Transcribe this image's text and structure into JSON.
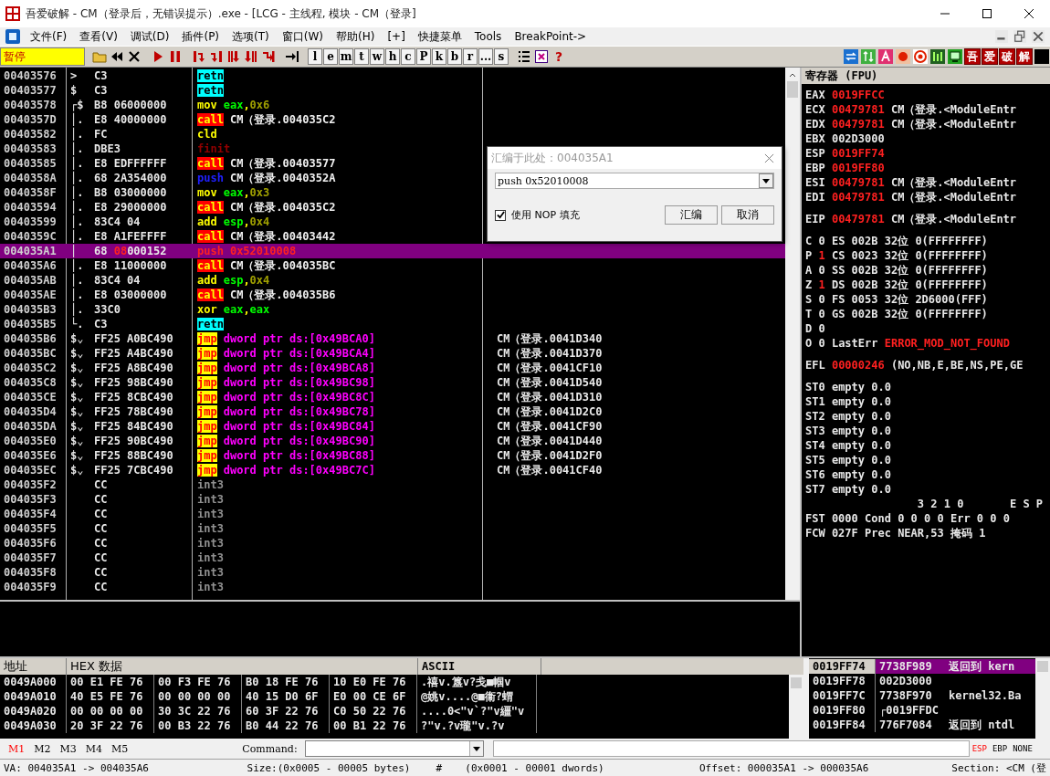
{
  "window": {
    "title": "吾爱破解 - CM（登录后，无错误提示）.exe - [LCG -  主线程, 模块 - CM（登录]"
  },
  "menu": [
    "文件(F)",
    "查看(V)",
    "调试(D)",
    "插件(P)",
    "选项(T)",
    "窗口(W)",
    "帮助(H)",
    "[+]",
    "快捷菜单",
    "Tools",
    "BreakPoint->"
  ],
  "toolbar": {
    "status": "暂停",
    "letter_buttons": [
      "l",
      "e",
      "m",
      "t",
      "w",
      "h",
      "c",
      "P",
      "k",
      "b",
      "r",
      "...",
      "s"
    ],
    "help": "?",
    "brand_buttons": [
      "吾",
      "爱",
      "破",
      "解"
    ]
  },
  "disassembly": {
    "rows": [
      {
        "address": "00403576",
        "mark": ">",
        "bytes": "C3",
        "mnemonic": "retn",
        "kind": "return",
        "operands": [],
        "selected": false
      },
      {
        "address": "00403577",
        "mark": "$",
        "bytes": "C3",
        "mnemonic": "retn",
        "kind": "return",
        "operands": [],
        "selected": false
      },
      {
        "address": "00403578",
        "mark": "┌$",
        "bytes": "B8 06000000",
        "mnemonic": "mov",
        "kind": "plain",
        "operands": [
          {
            "text": "eax",
            "kind": "reg"
          },
          {
            "text": ",",
            "kind": "punct"
          },
          {
            "text": "0x6",
            "kind": "imm"
          }
        ],
        "selected": false
      },
      {
        "address": "0040357D",
        "mark": "│.",
        "bytes": "E8 40000000",
        "mnemonic": "call",
        "kind": "call",
        "operands": [
          {
            "text": "CM（登录.004035C2",
            "kind": "symbol"
          }
        ],
        "selected": false
      },
      {
        "address": "00403582",
        "mark": "│.",
        "bytes": "FC",
        "mnemonic": "cld",
        "kind": "plain",
        "operands": [],
        "selected": false
      },
      {
        "address": "00403583",
        "mark": "│.",
        "bytes": "DBE3",
        "mnemonic": "finit",
        "kind": "fpu",
        "operands": [],
        "selected": false
      },
      {
        "address": "00403585",
        "mark": "│.",
        "bytes": "E8 EDFFFFFF",
        "mnemonic": "call",
        "kind": "call",
        "operands": [
          {
            "text": "CM（登录.00403577",
            "kind": "symbol"
          }
        ],
        "selected": false
      },
      {
        "address": "0040358A",
        "mark": "│.",
        "bytes": "68 2A354000",
        "mnemonic": "push",
        "kind": "push",
        "operands": [
          {
            "text": "CM（登录.0040352A",
            "kind": "symbol"
          }
        ],
        "selected": false
      },
      {
        "address": "0040358F",
        "mark": "│.",
        "bytes": "B8 03000000",
        "mnemonic": "mov",
        "kind": "plain",
        "operands": [
          {
            "text": "eax",
            "kind": "reg"
          },
          {
            "text": ",",
            "kind": "punct"
          },
          {
            "text": "0x3",
            "kind": "imm"
          }
        ],
        "selected": false
      },
      {
        "address": "00403594",
        "mark": "│.",
        "bytes": "E8 29000000",
        "mnemonic": "call",
        "kind": "call",
        "operands": [
          {
            "text": "CM（登录.004035C2",
            "kind": "symbol"
          }
        ],
        "selected": false
      },
      {
        "address": "00403599",
        "mark": "│.",
        "bytes": "83C4 04",
        "mnemonic": "add",
        "kind": "plain",
        "operands": [
          {
            "text": "esp",
            "kind": "reg"
          },
          {
            "text": ",",
            "kind": "punct"
          },
          {
            "text": "0x4",
            "kind": "imm"
          }
        ],
        "selected": false
      },
      {
        "address": "0040359C",
        "mark": "│.",
        "bytes": "E8 A1FEFFFF",
        "mnemonic": "call",
        "kind": "call",
        "operands": [
          {
            "text": "CM（登录.00403442",
            "kind": "symbol"
          }
        ],
        "selected": false
      },
      {
        "address": "004035A1",
        "mark": "│",
        "bytes": [
          {
            "text": "68 ",
            "changed": false
          },
          {
            "text": "08",
            "changed": true
          },
          {
            "text": "000152",
            "changed": false
          }
        ],
        "mnemonic": "push",
        "kind": "push",
        "operands": [
          {
            "text": "0x52010008",
            "kind": "imm"
          }
        ],
        "selected": true
      },
      {
        "address": "004035A6",
        "mark": "│.",
        "bytes": "E8 11000000",
        "mnemonic": "call",
        "kind": "call",
        "operands": [
          {
            "text": "CM（登录.004035BC",
            "kind": "symbol"
          }
        ],
        "selected": false
      },
      {
        "address": "004035AB",
        "mark": "│.",
        "bytes": "83C4 04",
        "mnemonic": "add",
        "kind": "plain",
        "operands": [
          {
            "text": "esp",
            "kind": "reg"
          },
          {
            "text": ",",
            "kind": "punct"
          },
          {
            "text": "0x4",
            "kind": "imm"
          }
        ],
        "selected": false
      },
      {
        "address": "004035AE",
        "mark": "│.",
        "bytes": "E8 03000000",
        "mnemonic": "call",
        "kind": "call",
        "operands": [
          {
            "text": "CM（登录.004035B6",
            "kind": "symbol"
          }
        ],
        "selected": false
      },
      {
        "address": "004035B3",
        "mark": "│.",
        "bytes": "33C0",
        "mnemonic": "xor",
        "kind": "plain",
        "operands": [
          {
            "text": "eax",
            "kind": "reg"
          },
          {
            "text": ",",
            "kind": "punct"
          },
          {
            "text": "eax",
            "kind": "reg"
          }
        ],
        "selected": false
      },
      {
        "address": "004035B5",
        "mark": "└.",
        "bytes": "C3",
        "mnemonic": "retn",
        "kind": "return",
        "operands": [],
        "selected": false
      },
      {
        "address": "004035B6",
        "mark": "$⌄",
        "bytes": "FF25 A0BC490",
        "mnemonic": "jmp",
        "kind": "jump",
        "operands": [
          {
            "text": "dword ptr ds:[0x49BCA0]",
            "kind": "mem"
          }
        ],
        "comment": "CM（登录.0041D340",
        "selected": false
      },
      {
        "address": "004035BC",
        "mark": "$⌄",
        "bytes": "FF25 A4BC490",
        "mnemonic": "jmp",
        "kind": "jump",
        "operands": [
          {
            "text": "dword ptr ds:[0x49BCA4]",
            "kind": "mem"
          }
        ],
        "comment": "CM（登录.0041D370",
        "selected": false
      },
      {
        "address": "004035C2",
        "mark": "$⌄",
        "bytes": "FF25 A8BC490",
        "mnemonic": "jmp",
        "kind": "jump",
        "operands": [
          {
            "text": "dword ptr ds:[0x49BCA8]",
            "kind": "mem"
          }
        ],
        "comment": "CM（登录.0041CF10",
        "selected": false
      },
      {
        "address": "004035C8",
        "mark": "$⌄",
        "bytes": "FF25 98BC490",
        "mnemonic": "jmp",
        "kind": "jump",
        "operands": [
          {
            "text": "dword ptr ds:[0x49BC98]",
            "kind": "mem"
          }
        ],
        "comment": "CM（登录.0041D540",
        "selected": false
      },
      {
        "address": "004035CE",
        "mark": "$⌄",
        "bytes": "FF25 8CBC490",
        "mnemonic": "jmp",
        "kind": "jump",
        "operands": [
          {
            "text": "dword ptr ds:[0x49BC8C]",
            "kind": "mem"
          }
        ],
        "comment": "CM（登录.0041D310",
        "selected": false
      },
      {
        "address": "004035D4",
        "mark": "$⌄",
        "bytes": "FF25 78BC490",
        "mnemonic": "jmp",
        "kind": "jump",
        "operands": [
          {
            "text": "dword ptr ds:[0x49BC78]",
            "kind": "mem"
          }
        ],
        "comment": "CM（登录.0041D2C0",
        "selected": false
      },
      {
        "address": "004035DA",
        "mark": "$⌄",
        "bytes": "FF25 84BC490",
        "mnemonic": "jmp",
        "kind": "jump",
        "operands": [
          {
            "text": "dword ptr ds:[0x49BC84]",
            "kind": "mem"
          }
        ],
        "comment": "CM（登录.0041CF90",
        "selected": false
      },
      {
        "address": "004035E0",
        "mark": "$⌄",
        "bytes": "FF25 90BC490",
        "mnemonic": "jmp",
        "kind": "jump",
        "operands": [
          {
            "text": "dword ptr ds:[0x49BC90]",
            "kind": "mem"
          }
        ],
        "comment": "CM（登录.0041D440",
        "selected": false
      },
      {
        "address": "004035E6",
        "mark": "$⌄",
        "bytes": "FF25 88BC490",
        "mnemonic": "jmp",
        "kind": "jump",
        "operands": [
          {
            "text": "dword ptr ds:[0x49BC88]",
            "kind": "mem"
          }
        ],
        "comment": "CM（登录.0041D2F0",
        "selected": false
      },
      {
        "address": "004035EC",
        "mark": "$⌄",
        "bytes": "FF25 7CBC490",
        "mnemonic": "jmp",
        "kind": "jump",
        "operands": [
          {
            "text": "dword ptr ds:[0x49BC7C]",
            "kind": "mem"
          }
        ],
        "comment": "CM（登录.0041CF40",
        "selected": false
      },
      {
        "address": "004035F2",
        "bytes": "CC",
        "mnemonic": "int3",
        "kind": "pad",
        "operands": [],
        "selected": false
      },
      {
        "address": "004035F3",
        "bytes": "CC",
        "mnemonic": "int3",
        "kind": "pad",
        "operands": [],
        "selected": false
      },
      {
        "address": "004035F4",
        "bytes": "CC",
        "mnemonic": "int3",
        "kind": "pad",
        "operands": [],
        "selected": false
      },
      {
        "address": "004035F5",
        "bytes": "CC",
        "mnemonic": "int3",
        "kind": "pad",
        "operands": [],
        "selected": false
      },
      {
        "address": "004035F6",
        "bytes": "CC",
        "mnemonic": "int3",
        "kind": "pad",
        "operands": [],
        "selected": false
      },
      {
        "address": "004035F7",
        "bytes": "CC",
        "mnemonic": "int3",
        "kind": "pad",
        "operands": [],
        "selected": false
      },
      {
        "address": "004035F8",
        "bytes": "CC",
        "mnemonic": "int3",
        "kind": "pad",
        "operands": [],
        "selected": false
      },
      {
        "address": "004035F9",
        "bytes": "CC",
        "mnemonic": "int3",
        "kind": "pad",
        "operands": [],
        "selected": false
      }
    ]
  },
  "assemble_dialog": {
    "title": "汇编于此处：004035A1",
    "value": "push 0x52010008",
    "nop_fill": {
      "label": "使用 NOP 填充",
      "checked": true
    },
    "buttons": [
      "汇编",
      "取消"
    ]
  },
  "registers": {
    "title": "寄存器 (FPU)",
    "groups": [
      {
        "lines": [
          {
            "kind": "normal",
            "parts": [
              {
                "text": "EAX",
                "changed": false
              },
              {
                "text": "0019FFCC",
                "changed": true
              }
            ]
          },
          {
            "kind": "normal",
            "parts": [
              {
                "text": "ECX",
                "changed": false
              },
              {
                "text": "00479781",
                "changed": true
              },
              {
                "text": "CM（登录.<ModuleEntr",
                "changed": false
              }
            ]
          },
          {
            "kind": "normal",
            "parts": [
              {
                "text": "EDX",
                "changed": false
              },
              {
                "text": "00479781",
                "changed": true
              },
              {
                "text": "CM（登录.<ModuleEntr",
                "changed": false
              }
            ]
          },
          {
            "kind": "normal",
            "parts": [
              {
                "text": "EBX",
                "changed": false
              },
              {
                "text": "002D3000",
                "changed": false
              }
            ]
          },
          {
            "kind": "normal",
            "parts": [
              {
                "text": "ESP",
                "changed": false
              },
              {
                "text": "0019FF74",
                "changed": true
              }
            ]
          },
          {
            "kind": "normal",
            "parts": [
              {
                "text": "EBP",
                "changed": false
              },
              {
                "text": "0019FF80",
                "changed": true
              }
            ]
          },
          {
            "kind": "normal",
            "parts": [
              {
                "text": "ESI",
                "changed": false
              },
              {
                "text": "00479781",
                "changed": true
              },
              {
                "text": "CM（登录.<ModuleEntr",
                "changed": false
              }
            ]
          },
          {
            "kind": "normal",
            "parts": [
              {
                "text": "EDI",
                "changed": false
              },
              {
                "text": "00479781",
                "changed": true
              },
              {
                "text": "CM（登录.<ModuleEntr",
                "changed": false
              }
            ]
          }
        ]
      },
      {
        "lines": [
          {
            "kind": "normal",
            "parts": [
              {
                "text": "EIP",
                "changed": false
              },
              {
                "text": "00479781",
                "changed": true
              },
              {
                "text": "CM（登录.<ModuleEntr",
                "changed": false
              }
            ]
          }
        ]
      },
      {
        "lines": [
          {
            "kind": "normal",
            "parts": [
              {
                "text": "C",
                "changed": false
              },
              {
                "text": "0",
                "changed": false
              },
              {
                "text": "ES 002B 32位 0(FFFFFFFF)",
                "changed": false
              }
            ]
          },
          {
            "kind": "normal",
            "parts": [
              {
                "text": "P",
                "changed": false
              },
              {
                "text": "1",
                "changed": true
              },
              {
                "text": "CS 0023 32位 0(FFFFFFFF)",
                "changed": false
              }
            ]
          },
          {
            "kind": "normal",
            "parts": [
              {
                "text": "A",
                "changed": false
              },
              {
                "text": "0",
                "changed": false
              },
              {
                "text": "SS 002B 32位 0(FFFFFFFF)",
                "changed": false
              }
            ]
          },
          {
            "kind": "normal",
            "parts": [
              {
                "text": "Z",
                "changed": false
              },
              {
                "text": "1",
                "changed": true
              },
              {
                "text": "DS 002B 32位 0(FFFFFFFF)",
                "changed": false
              }
            ]
          },
          {
            "kind": "normal",
            "parts": [
              {
                "text": "S",
                "changed": false
              },
              {
                "text": "0",
                "changed": false
              },
              {
                "text": "FS 0053 32位 2D6000(FFF)",
                "changed": false
              }
            ]
          },
          {
            "kind": "normal",
            "parts": [
              {
                "text": "T",
                "changed": false
              },
              {
                "text": "0",
                "changed": false
              },
              {
                "text": "GS 002B 32位 0(FFFFFFFF)",
                "changed": false
              }
            ]
          },
          {
            "kind": "normal",
            "parts": [
              {
                "text": "D",
                "changed": false
              },
              {
                "text": "0",
                "changed": false
              }
            ]
          },
          {
            "kind": "normal",
            "parts": [
              {
                "text": "O",
                "changed": false
              },
              {
                "text": "0",
                "changed": false
              },
              {
                "text": "LastErr",
                "changed": false
              },
              {
                "text": "ERROR_MOD_NOT_FOUND",
                "changed": true
              }
            ]
          }
        ]
      },
      {
        "lines": [
          {
            "kind": "normal",
            "parts": [
              {
                "text": "EFL",
                "changed": false
              },
              {
                "text": "00000246",
                "changed": true
              },
              {
                "text": "(NO,NB,E,BE,NS,PE,GE",
                "changed": false
              }
            ]
          }
        ]
      },
      {
        "lines": [
          {
            "kind": "normal",
            "parts": [
              {
                "text": "ST0",
                "changed": false
              },
              {
                "text": "empty 0.0",
                "changed": false
              }
            ]
          },
          {
            "kind": "normal",
            "parts": [
              {
                "text": "ST1",
                "changed": false
              },
              {
                "text": "empty 0.0",
                "changed": false
              }
            ]
          },
          {
            "kind": "normal",
            "parts": [
              {
                "text": "ST2",
                "changed": false
              },
              {
                "text": "empty 0.0",
                "changed": false
              }
            ]
          },
          {
            "kind": "normal",
            "parts": [
              {
                "text": "ST3",
                "changed": false
              },
              {
                "text": "empty 0.0",
                "changed": false
              }
            ]
          },
          {
            "kind": "normal",
            "parts": [
              {
                "text": "ST4",
                "changed": false
              },
              {
                "text": "empty 0.0",
                "changed": false
              }
            ]
          },
          {
            "kind": "normal",
            "parts": [
              {
                "text": "ST5",
                "changed": false
              },
              {
                "text": "empty 0.0",
                "changed": false
              }
            ]
          },
          {
            "kind": "normal",
            "parts": [
              {
                "text": "ST6",
                "changed": false
              },
              {
                "text": "empty 0.0",
                "changed": false
              }
            ]
          },
          {
            "kind": "normal",
            "parts": [
              {
                "text": "ST7",
                "changed": false
              },
              {
                "text": "empty 0.0",
                "changed": false
              }
            ]
          },
          {
            "kind": "header",
            "parts": [
              {
                "text": "3 2 1 0",
                "changed": false
              },
              {
                "text": "E S P",
                "changed": false
              }
            ]
          },
          {
            "kind": "normal",
            "parts": [
              {
                "text": "FST 0000",
                "changed": false
              },
              {
                "text": "Cond 0 0 0 0",
                "changed": false
              },
              {
                "text": "Err 0 0 0",
                "changed": false
              }
            ]
          },
          {
            "kind": "normal",
            "parts": [
              {
                "text": "FCW 027F",
                "changed": false
              },
              {
                "text": "Prec NEAR,53",
                "changed": false
              },
              {
                "text": "掩码",
                "changed": false
              },
              {
                "text": "1",
                "changed": false
              }
            ]
          }
        ]
      }
    ]
  },
  "dump": {
    "columns": [
      "地址",
      "HEX 数据",
      "ASCII"
    ],
    "rows": [
      {
        "address": "0049A000",
        "hex": [
          "00 E1 FE 76",
          "00 F3 FE 76",
          "B0 18 FE 76",
          "10 E0 FE 76"
        ],
        "ascii": ".禧v.簋v?戋■帼v"
      },
      {
        "address": "0049A010",
        "hex": [
          "40 E5 FE 76",
          "00 00 00 00",
          "40 15 D0 6F",
          "E0 00 CE 6F"
        ],
        "ascii": "@姚v....@■衞?蝟"
      },
      {
        "address": "0049A020",
        "hex": [
          "00 00 00 00",
          "30 3C 22 76",
          "60 3F 22 76",
          "C0 50 22 76"
        ],
        "ascii": "....0<\"v`?\"v繮\"v"
      },
      {
        "address": "0049A030",
        "hex": [
          "20 3F 22 76",
          "00 B3 22 76",
          "B0 44 22 76",
          "00 B1 22 76"
        ],
        "ascii": "?\"v.?v瓏\"v.?v"
      }
    ]
  },
  "stack": {
    "rows": [
      {
        "address": "0019FF74",
        "value": "7738F989",
        "comment": "返回到 kern",
        "selected": true
      },
      {
        "address": "0019FF78",
        "value": "002D3000",
        "selected": false
      },
      {
        "address": "0019FF7C",
        "value": "7738F970",
        "comment": "kernel32.Ba",
        "selected": false
      },
      {
        "address": "0019FF80",
        "value": "┌0019FFDC",
        "selected": false
      },
      {
        "address": "0019FF84",
        "value": "776F7084",
        "comment": "返回到 ntdl",
        "selected": false
      }
    ]
  },
  "command_bar": {
    "memory_tabs": [
      {
        "label": "M1",
        "selected": true
      },
      {
        "label": "M2",
        "selected": false
      },
      {
        "label": "M3",
        "selected": false
      },
      {
        "label": "M4",
        "selected": false
      },
      {
        "label": "M5",
        "selected": false
      }
    ],
    "label": "Command:",
    "stack_modes": [
      {
        "label": "ESP",
        "selected": true
      },
      {
        "label": "EBP",
        "selected": false
      },
      {
        "label": "NONE",
        "selected": false
      }
    ]
  },
  "status_bar": [
    "VA: 004035A1 -> 004035A6",
    "Size:(0x0005 - 00005 bytes)",
    "#",
    "(0x0001 - 00001 dwords)",
    "Offset: 000035A1 -> 000035A6",
    "Section: <CM (登"
  ]
}
